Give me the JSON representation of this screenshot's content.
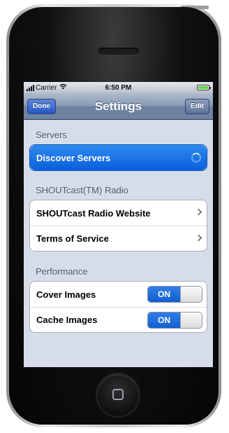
{
  "status_bar": {
    "carrier": "Carrier",
    "time": "6:50 PM",
    "battery_color": "#5fd14d"
  },
  "nav_bar": {
    "title": "Settings",
    "left_button": "Done",
    "right_button": "Edit"
  },
  "sections": {
    "servers": {
      "header": "Servers",
      "items": [
        {
          "label": "Discover Servers",
          "selected": true,
          "accessory": "spinner-icon"
        }
      ]
    },
    "radio": {
      "header": "SHOUTcast(TM) Radio",
      "items": [
        {
          "label": "SHOUTcast Radio Website",
          "accessory": "chevron-right-icon"
        },
        {
          "label": "Terms of Service",
          "accessory": "chevron-right-icon"
        }
      ]
    },
    "performance": {
      "header": "Performance",
      "items": [
        {
          "label": "Cover Images",
          "toggle": "ON"
        },
        {
          "label": "Cache Images",
          "toggle": "ON"
        }
      ]
    }
  },
  "colors": {
    "selection_blue": "#0a5fdb",
    "nav_bar": "#6d82a1",
    "table_background": "#d7dde8"
  }
}
